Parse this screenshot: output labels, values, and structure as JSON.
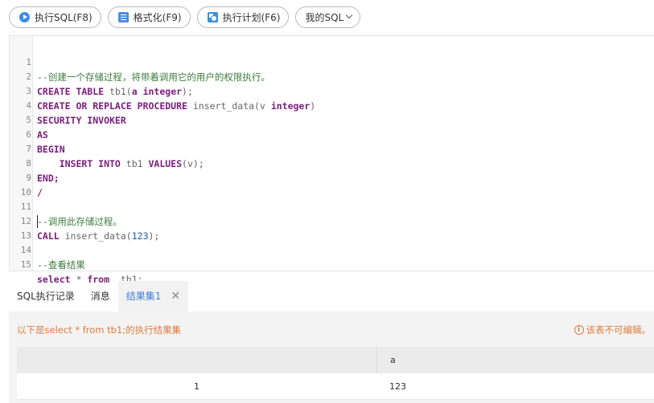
{
  "toolbar": {
    "run_label": "执行SQL(F8)",
    "format_label": "格式化(F9)",
    "plan_label": "执行计划(F6)",
    "mysql_label": "我的SQL"
  },
  "editor": {
    "line_numbers": [
      "1",
      "2",
      "3",
      "4",
      "5",
      "6",
      "7",
      "8",
      "9",
      "10",
      "11",
      "12",
      "13",
      "14",
      "15"
    ],
    "lines": {
      "l1": "--创建一个存储过程，将带着调用它的用户的权限执行。",
      "l2_kw": "CREATE TABLE",
      "l2_id": " tb1(",
      "l2_a": "a",
      "l2_kw2": " integer",
      "l2_end": ");",
      "l3_kw": "CREATE OR REPLACE PROCEDURE",
      "l3_id": " insert_data(",
      "l3_v": "v",
      "l3_kw2": " integer",
      "l3_end": ")",
      "l4": "SECURITY INVOKER",
      "l5": "AS",
      "l6": "BEGIN",
      "l7_kw": "    INSERT INTO",
      "l7_id": " tb1 ",
      "l7_kw2": "VALUES",
      "l7_id2": "(v);",
      "l8": "END;",
      "l9": "/",
      "l11": "--调用此存储过程。",
      "l12_kw": "CALL",
      "l12_id": " insert_data(",
      "l12_num": "123",
      "l12_end": ");",
      "l14": "--查看结果",
      "l15_kw": "select",
      "l15_star": " * ",
      "l15_kw2": "from",
      "l15_id": "  tb1;"
    }
  },
  "tabs": {
    "history": "SQL执行记录",
    "messages": "消息",
    "result1": "结果集1",
    "close": "✕"
  },
  "result": {
    "info": "以下是select * from tb1;的执行结果集",
    "readonly_icon": "i",
    "readonly": "该表不可编辑。",
    "column_header": "a",
    "rows": [
      {
        "index": "1",
        "a": "123"
      }
    ]
  }
}
